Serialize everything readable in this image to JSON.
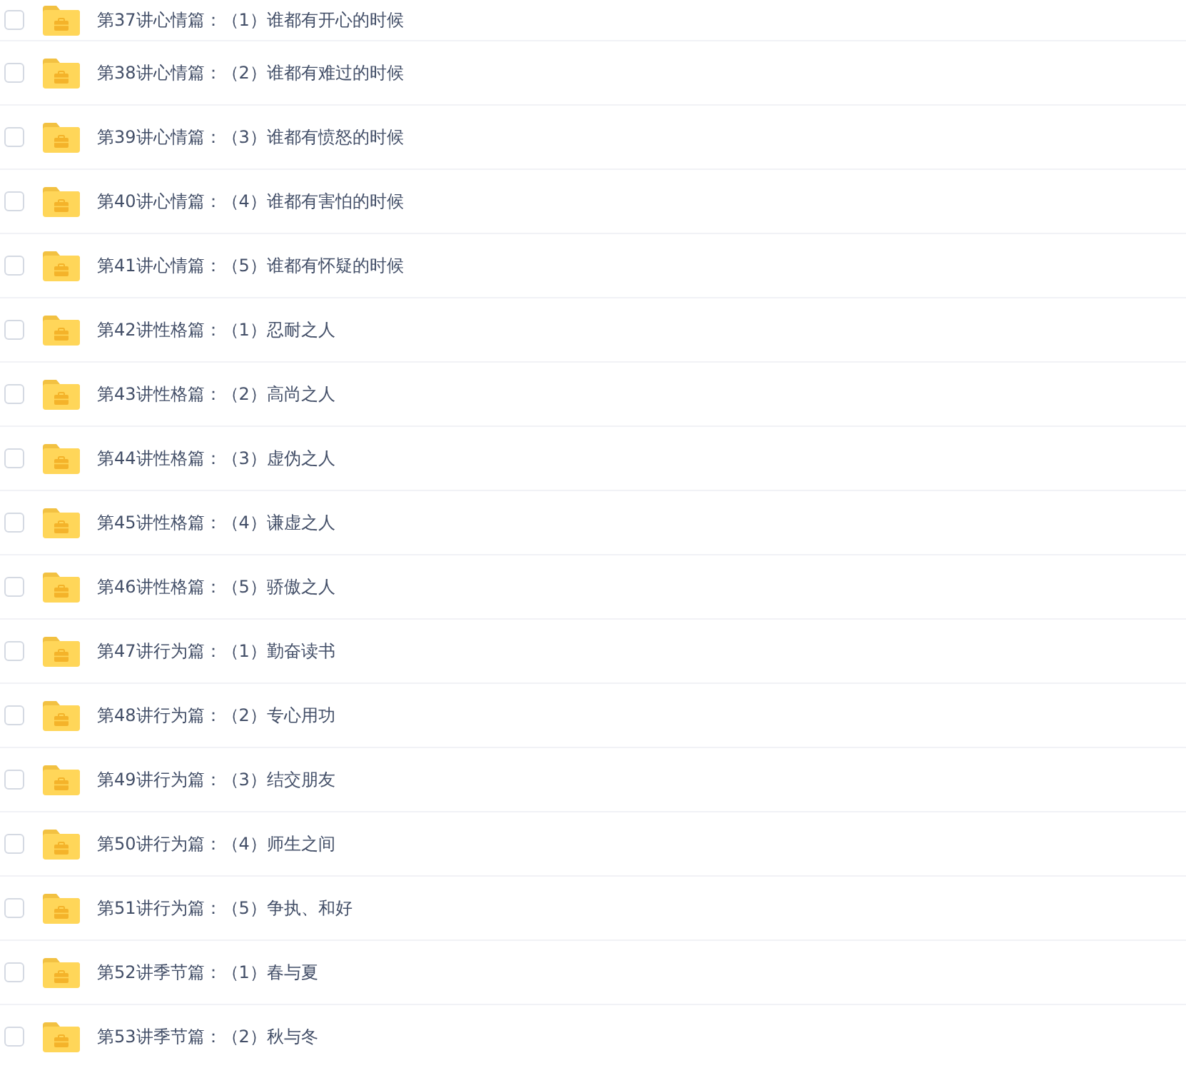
{
  "rows": [
    {
      "title": "第37讲心情篇：（1）谁都有开心的时候",
      "checked": false
    },
    {
      "title": "第38讲心情篇：（2）谁都有难过的时候",
      "checked": false
    },
    {
      "title": "第39讲心情篇：（3）谁都有愤怒的时候",
      "checked": false
    },
    {
      "title": "第40讲心情篇：（4）谁都有害怕的时候",
      "checked": false
    },
    {
      "title": "第41讲心情篇：（5）谁都有怀疑的时候",
      "checked": false
    },
    {
      "title": "第42讲性格篇：（1）忍耐之人",
      "checked": false
    },
    {
      "title": "第43讲性格篇：（2）高尚之人",
      "checked": false
    },
    {
      "title": "第44讲性格篇：（3）虚伪之人",
      "checked": false
    },
    {
      "title": "第45讲性格篇：（4）谦虚之人",
      "checked": false
    },
    {
      "title": "第46讲性格篇：（5）骄傲之人",
      "checked": false
    },
    {
      "title": "第47讲行为篇：（1）勤奋读书",
      "checked": false
    },
    {
      "title": "第48讲行为篇：（2）专心用功",
      "checked": false
    },
    {
      "title": "第49讲行为篇：（3）结交朋友",
      "checked": false
    },
    {
      "title": "第50讲行为篇：（4）师生之间",
      "checked": false
    },
    {
      "title": "第51讲行为篇：（5）争执、和好",
      "checked": false
    },
    {
      "title": "第52讲季节篇：（1）春与夏",
      "checked": false
    },
    {
      "title": "第53讲季节篇：（2）秋与冬",
      "checked": false
    }
  ]
}
